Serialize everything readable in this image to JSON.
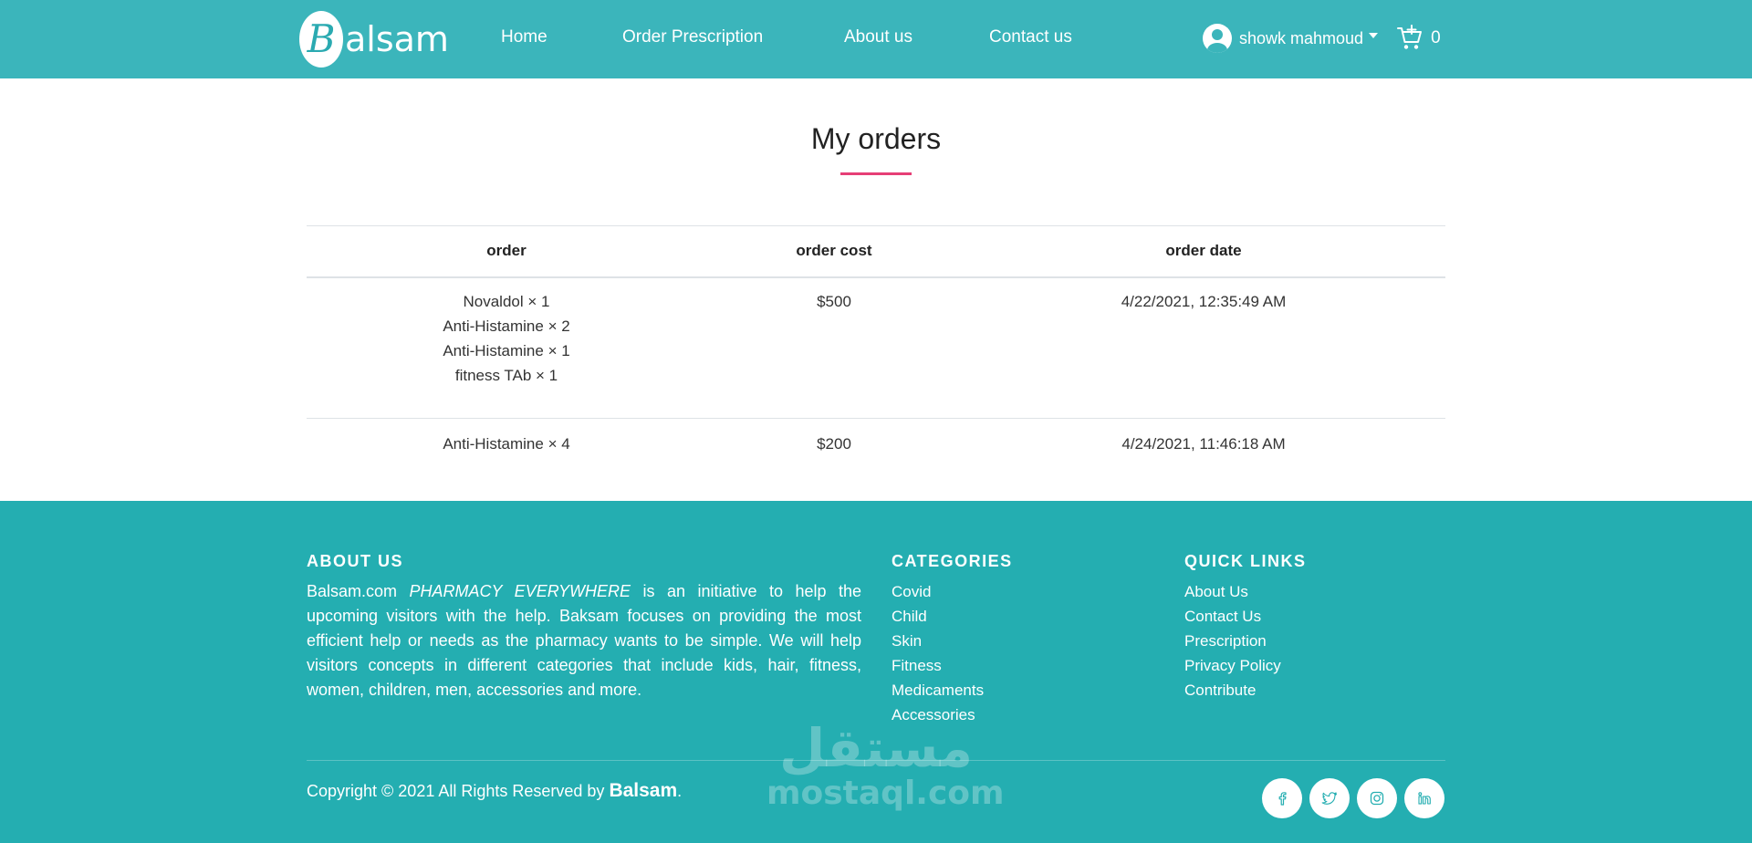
{
  "nav": {
    "logo_initial": "B",
    "logo_rest": "alsam",
    "links": [
      "Home",
      "Order Prescription",
      "About us",
      "Contact us"
    ],
    "user_name": "showk mahmoud",
    "cart_count": "0"
  },
  "main": {
    "title": "My orders",
    "headers": [
      "order",
      "order cost",
      "order date"
    ],
    "orders": [
      {
        "items": [
          "Novaldol × 1",
          "Anti-Histamine × 2",
          "Anti-Histamine × 1",
          "fitness TAb × 1"
        ],
        "cost": "$500",
        "date": "4/22/2021, 12:35:49 AM"
      },
      {
        "items": [
          "Anti-Histamine × 4"
        ],
        "cost": "$200",
        "date": "4/24/2021, 11:46:18 AM"
      }
    ]
  },
  "footer": {
    "about_heading": "ABOUT US",
    "about_text_start": "Balsam.com ",
    "about_text_em": "PHARMACY EVERYWHERE",
    "about_text_rest": " is an initiative to help the upcoming visitors with the help. Baksam focuses on providing the most efficient help or needs as the pharmacy wants to be simple. We will help visitors concepts in different categories that include kids, hair, fitness, women, children, men, accessories and more.",
    "categories_heading": "CATEGORIES",
    "categories": [
      "Covid",
      "Child",
      "Skin",
      "Fitness",
      "Medicaments",
      "Accessories"
    ],
    "quick_links_heading": "QUICK LINKS",
    "quick_links": [
      "About Us",
      "Contact Us",
      "Prescription",
      "Privacy Policy",
      "Contribute"
    ],
    "copyright_text": "Copyright © 2021 All Rights Reserved by ",
    "copyright_brand": "Balsam",
    "copyright_end": ".",
    "socials": [
      "facebook-icon",
      "twitter-icon",
      "instagram-icon",
      "linkedin-icon"
    ]
  },
  "watermark": {
    "arabic": "مستقل",
    "latin": "mostaql.com"
  },
  "colors": {
    "primary": "#3bb5bb",
    "footer": "#24aeb1",
    "accent": "#e63e76"
  }
}
